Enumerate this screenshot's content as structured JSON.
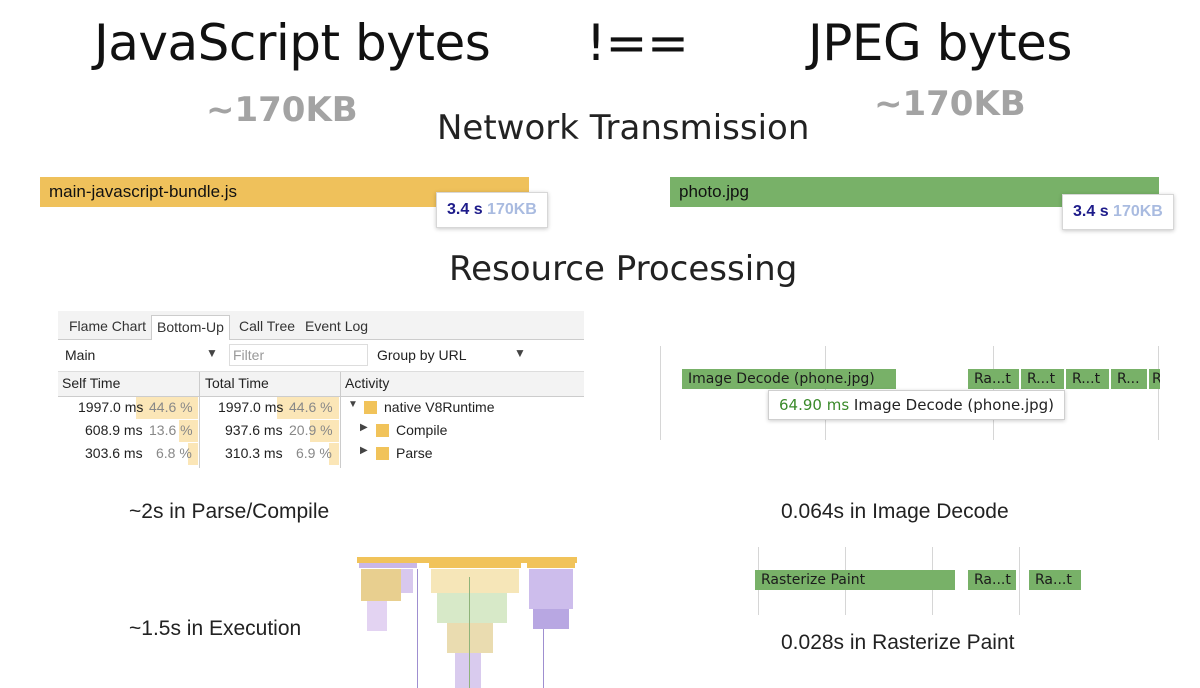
{
  "title": {
    "left": "JavaScript bytes",
    "operator": "!==",
    "right": "JPEG bytes"
  },
  "sizes": {
    "js": "~170KB",
    "jpeg": "~170KB"
  },
  "sections": {
    "network": "Network Transmission",
    "processing": "Resource Processing"
  },
  "network": {
    "js": {
      "file": "main-javascript-bundle.js",
      "time": "3.4 s",
      "size": "170KB",
      "color": "#efc15b"
    },
    "jpeg": {
      "file": "photo.jpg",
      "time": "3.4 s",
      "size": "170KB",
      "color": "#78b168"
    }
  },
  "devtools": {
    "tabs": [
      "Flame Chart",
      "Bottom-Up",
      "Call Tree",
      "Event Log"
    ],
    "active_tab": "Bottom-Up",
    "thread_select": "Main",
    "filter_placeholder": "Filter",
    "group_select": "Group by URL",
    "columns": [
      "Self Time",
      "Total Time",
      "Activity"
    ],
    "rows": [
      {
        "self_ms": "1997.0 ms",
        "self_pct": "44.6 %",
        "total_ms": "1997.0 ms",
        "total_pct": "44.6 %",
        "activity": "native V8Runtime",
        "expanded": true
      },
      {
        "self_ms": "608.9 ms",
        "self_pct": "13.6 %",
        "total_ms": "937.6 ms",
        "total_pct": "20.9 %",
        "activity": "Compile",
        "expanded": false
      },
      {
        "self_ms": "303.6 ms",
        "self_pct": "6.8 %",
        "total_ms": "310.3 ms",
        "total_pct": "6.9 %",
        "activity": "Parse",
        "expanded": false
      }
    ],
    "self_fraction": [
      0.446,
      0.136,
      0.068
    ],
    "total_fraction": [
      0.446,
      0.209,
      0.069
    ]
  },
  "decode": {
    "bar_label": "Image Decode (phone.jpg)",
    "small_bars": [
      "Ra...t",
      "R...t",
      "R...t",
      "R...",
      "R"
    ],
    "tooltip_time": "64.90 ms",
    "tooltip_label": "Image Decode (phone.jpg)"
  },
  "raster": {
    "bar_label": "Rasterize Paint",
    "small_bars": [
      "Ra...t",
      "Ra...t"
    ]
  },
  "captions": {
    "parse_compile": "~2s in Parse/Compile",
    "execution": "~1.5s in Execution",
    "image_decode": "0.064s in Image Decode",
    "rasterize": "0.028s in Rasterize Paint"
  }
}
